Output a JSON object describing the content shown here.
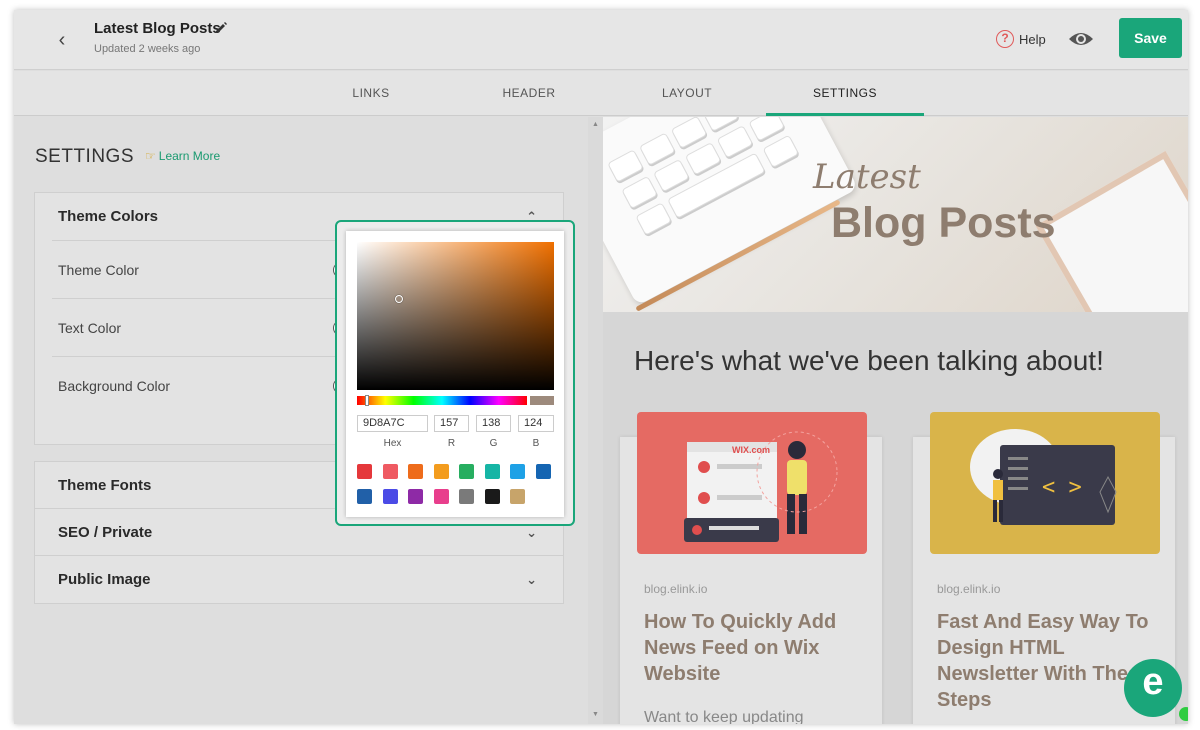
{
  "header": {
    "title": "Latest Blog Posts",
    "updated": "Updated 2 weeks ago",
    "help_label": "Help",
    "save_label": "Save"
  },
  "tabs": [
    {
      "label": "LINKS"
    },
    {
      "label": "HEADER"
    },
    {
      "label": "LAYOUT"
    },
    {
      "label": "SETTINGS",
      "active": true
    }
  ],
  "settings": {
    "title": "SETTINGS",
    "learn_more": "Learn More",
    "theme_colors": {
      "heading": "Theme Colors",
      "rows": [
        "Theme Color",
        "Text Color",
        "Background Color"
      ]
    },
    "sections": [
      "Theme Fonts",
      "SEO / Private",
      "Public Image"
    ]
  },
  "picker": {
    "hex": "9D8A7C",
    "r": "157",
    "g": "138",
    "b": "124",
    "labels": {
      "hex": "Hex",
      "r": "R",
      "g": "G",
      "b": "B"
    },
    "selected_color": "#9D8A7C",
    "swatches": [
      "#e5383b",
      "#ef5a62",
      "#ee6c1b",
      "#f39c1e",
      "#27ae60",
      "#16b5a5",
      "#1ea1e6",
      "#1565b2",
      "#2160a8",
      "#4b4be6",
      "#8e2aa6",
      "#e83e8c",
      "#7a7a7a",
      "#1a1a1a",
      "#c7a46a"
    ]
  },
  "preview": {
    "banner_script": "Latest",
    "banner_title": "Blog Posts",
    "heading": "Here's what we've been talking about!",
    "posts": [
      {
        "source": "blog.elink.io",
        "title": "How To Quickly Add News Feed on Wix Website",
        "desc": "Want to keep updating",
        "image_bg": "#e56a63",
        "image_label": "WIX.com"
      },
      {
        "source": "blog.elink.io",
        "title": "Fast And Easy Way To Design HTML Newsletter With These Steps",
        "desc": "",
        "image_bg": "#d9b44a",
        "image_label": "< >"
      }
    ]
  },
  "colors": {
    "accent": "#1aa67a",
    "brand_text": "#8e7d6f"
  }
}
